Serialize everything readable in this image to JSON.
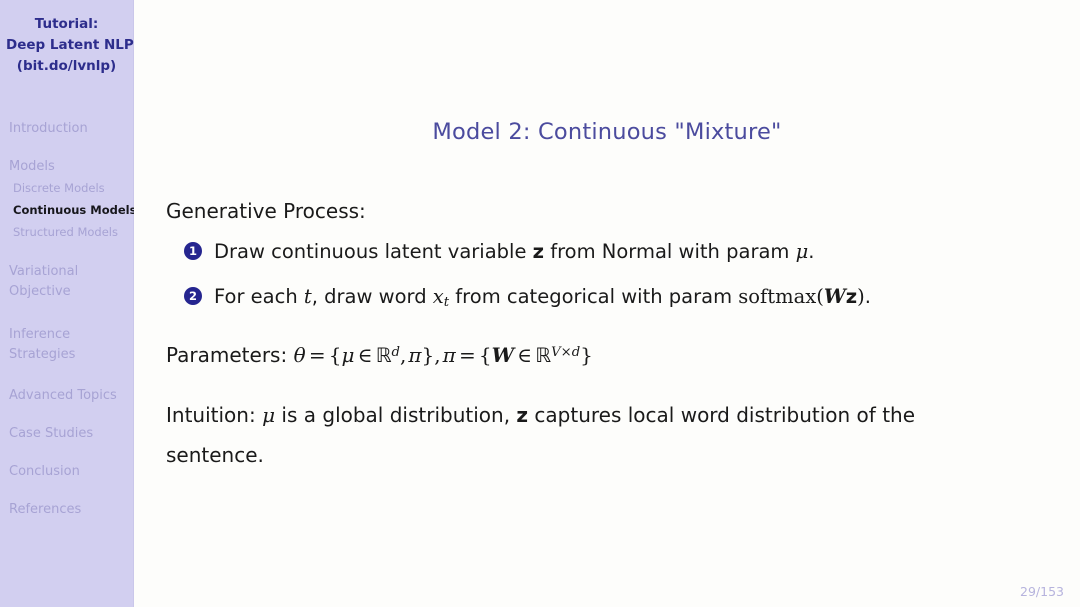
{
  "sidebar": {
    "title_lines": [
      "Tutorial:",
      "Deep Latent NLP",
      "(bit.do/lvnlp)"
    ],
    "items": [
      {
        "label": "Introduction",
        "level": "section",
        "active": false
      },
      {
        "label": "Models",
        "level": "section",
        "active": false
      },
      {
        "label": "Discrete Models",
        "level": "subsection",
        "active": false
      },
      {
        "label": "Continuous Models",
        "level": "subsection",
        "active": true
      },
      {
        "label": "Structured Models",
        "level": "subsection",
        "active": false
      },
      {
        "label": "Variational",
        "level": "section",
        "active": false
      },
      {
        "label": "Objective",
        "level": "section-cont",
        "active": false
      },
      {
        "label": "Inference",
        "level": "section",
        "active": false
      },
      {
        "label": "Strategies",
        "level": "section-cont",
        "active": false
      },
      {
        "label": "Advanced Topics",
        "level": "section",
        "active": false
      },
      {
        "label": "Case Studies",
        "level": "section",
        "active": false
      },
      {
        "label": "Conclusion",
        "level": "section",
        "active": false
      },
      {
        "label": "References",
        "level": "section",
        "active": false
      }
    ]
  },
  "slide": {
    "title": "Model 2: Continuous \"Mixture\"",
    "generative_process_label": "Generative Process:",
    "enumerated": [
      {
        "marker": "1",
        "text": "Draw continuous latent variable z from Normal with param μ."
      },
      {
        "marker": "2",
        "text": "For each t, draw word x_t from categorical with param softmax(Wz)."
      }
    ],
    "parameters_label": "Parameters:",
    "parameters_math": "θ = {μ ∈ ℝ^d, π}, π = {W ∈ ℝ^{V×d}}",
    "intuition_label": "Intuition:",
    "intuition_text": "μ is a global distribution, z captures local word distribution of the sentence.",
    "page_number": "29/153"
  },
  "colors": {
    "sidebar_bg": "#d2cff0",
    "sidebar_title": "#2d2d8c",
    "nav_inactive": "#a7a3d4",
    "nav_active": "#17171c",
    "title": "#4b4b9e",
    "marker_bg": "#25258f",
    "page_number": "#b6b3dd",
    "body_text": "#1a1a1a"
  }
}
